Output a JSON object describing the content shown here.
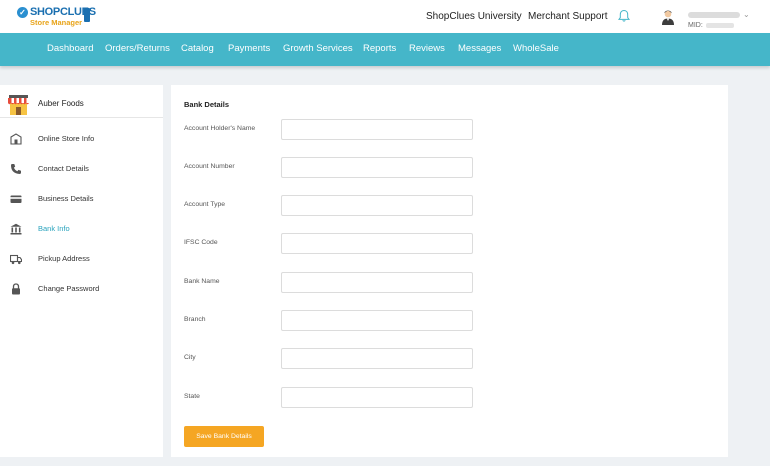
{
  "brand": {
    "name": "SHOPCLUES",
    "subtitle": "Store Manager"
  },
  "header": {
    "links": [
      "ShopClues University",
      "Merchant Support"
    ],
    "mid_label": "MID:"
  },
  "nav": {
    "items": [
      "Dashboard",
      "Orders/Returns",
      "Catalog",
      "Payments",
      "Growth Services",
      "Reports",
      "Reviews",
      "Messages",
      "WholeSale"
    ]
  },
  "sidebar": {
    "store_name": "Auber Foods",
    "items": [
      {
        "label": "Online Store Info",
        "icon": "store-icon",
        "active": false
      },
      {
        "label": "Contact Details",
        "icon": "phone-icon",
        "active": false
      },
      {
        "label": "Business Details",
        "icon": "card-icon",
        "active": false
      },
      {
        "label": "Bank Info",
        "icon": "bank-icon",
        "active": true
      },
      {
        "label": "Pickup Address",
        "icon": "truck-icon",
        "active": false
      },
      {
        "label": "Change Password",
        "icon": "lock-icon",
        "active": false
      }
    ]
  },
  "form": {
    "title": "Bank Details",
    "fields": [
      {
        "label": "Account Holder's Name",
        "value": ""
      },
      {
        "label": "Account Number",
        "value": ""
      },
      {
        "label": "Account Type",
        "value": ""
      },
      {
        "label": "IFSC Code",
        "value": ""
      },
      {
        "label": "Bank Name",
        "value": ""
      },
      {
        "label": "Branch",
        "value": ""
      },
      {
        "label": "City",
        "value": ""
      },
      {
        "label": "State",
        "value": ""
      }
    ],
    "save_label": "Save Bank Details"
  },
  "colors": {
    "nav_bg": "#45b6c9",
    "accent": "#2aa3bd",
    "button": "#f5a623",
    "brand_blue": "#1a6fb0",
    "brand_orange": "#e8a41a"
  }
}
